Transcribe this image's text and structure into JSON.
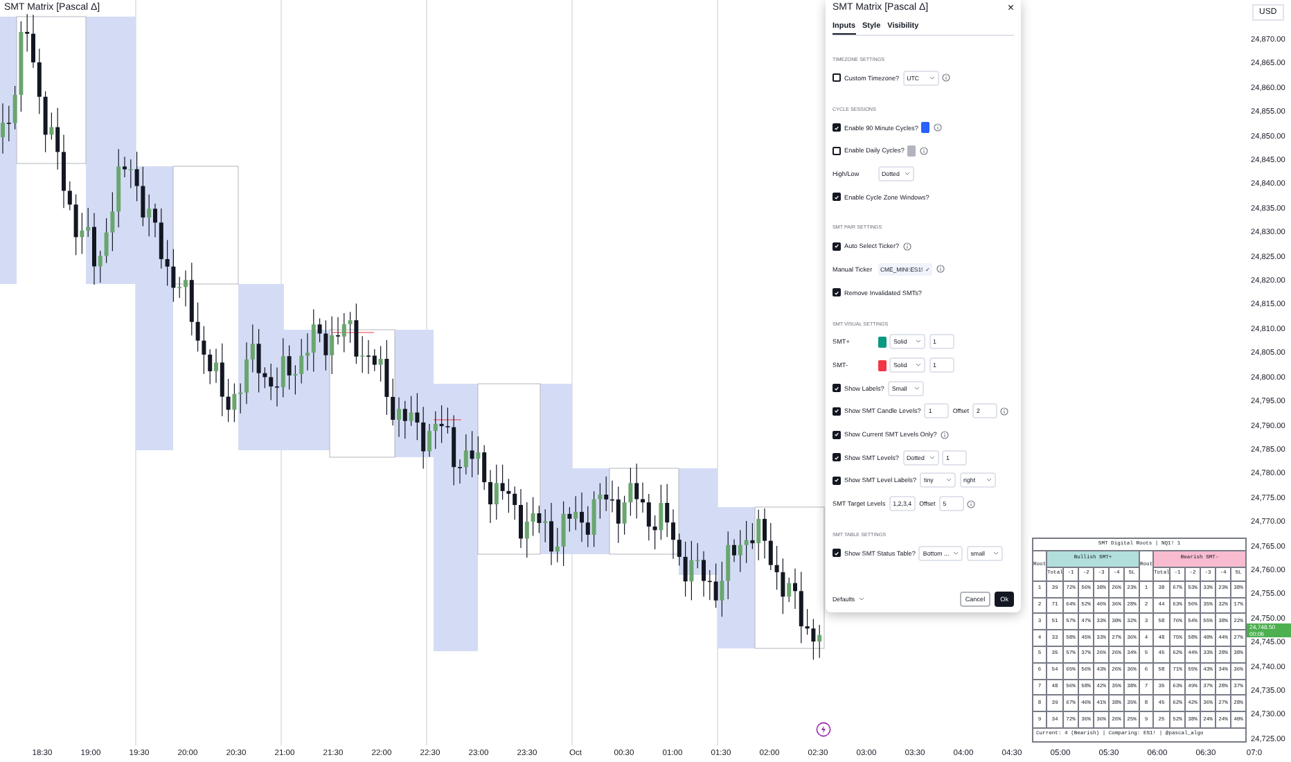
{
  "chart": {
    "legend": "SMT Matrix [Pascal Δ]"
  },
  "dialog": {
    "title": "SMT Matrix [Pascal Δ]",
    "close": "×",
    "tabs": [
      {
        "label": "Inputs",
        "selected": true
      },
      {
        "label": "Style",
        "selected": false
      },
      {
        "label": "Visibility",
        "selected": false
      }
    ],
    "rows": [
      {
        "kind": "section",
        "label": "TIMEZONE SETTINGS"
      },
      {
        "kind": "check",
        "label": "Custom Timezone?",
        "checked": false,
        "controls": [
          {
            "kind": "select",
            "value": "UTC"
          },
          {
            "kind": "info"
          }
        ]
      },
      {
        "kind": "section",
        "label": "CYCLE SESSIONS"
      },
      {
        "kind": "check",
        "label": "Enable 90 Minute Cycles?",
        "checked": true,
        "controls": [
          {
            "kind": "swatch",
            "color": "#2962ff"
          },
          {
            "kind": "info"
          }
        ]
      },
      {
        "kind": "check",
        "label": "Enable Daily Cycles?",
        "checked": false,
        "controls": [
          {
            "kind": "swatch",
            "color": "#b2b5be"
          },
          {
            "kind": "info"
          }
        ]
      },
      {
        "kind": "field",
        "label": "High/Low",
        "controls": [
          {
            "kind": "select",
            "value": "Dotted"
          }
        ]
      },
      {
        "kind": "check",
        "label": "Enable Cycle Zone Windows?",
        "checked": true,
        "controls": []
      },
      {
        "kind": "section",
        "label": "SMT PAIR SETTINGS"
      },
      {
        "kind": "check",
        "label": "Auto Select Ticker?",
        "checked": true,
        "controls": [
          {
            "kind": "info"
          }
        ]
      },
      {
        "kind": "field",
        "label": "Manual Ticker",
        "controls": [
          {
            "kind": "ticker",
            "value": "CME_MINI:ES1!",
            "mark": "✓"
          },
          {
            "kind": "info"
          }
        ]
      },
      {
        "kind": "check",
        "label": "Remove Invalidated SMTs?",
        "checked": true,
        "controls": []
      },
      {
        "kind": "section",
        "label": "SMT VISUAL SETTINGS"
      },
      {
        "kind": "field",
        "label": "SMT+",
        "controls": [
          {
            "kind": "swatch",
            "color": "#089981"
          },
          {
            "kind": "select",
            "value": "Solid"
          },
          {
            "kind": "input",
            "value": "1"
          }
        ]
      },
      {
        "kind": "field",
        "label": "SMT-",
        "controls": [
          {
            "kind": "swatch",
            "color": "#f23645"
          },
          {
            "kind": "select",
            "value": "Solid"
          },
          {
            "kind": "input",
            "value": "1"
          }
        ]
      },
      {
        "kind": "check",
        "label": "Show Labels?",
        "checked": true,
        "controls": [
          {
            "kind": "select",
            "value": "Small"
          }
        ]
      },
      {
        "kind": "check",
        "label": "Show SMT Candle Levels?",
        "checked": true,
        "controls": [
          {
            "kind": "input",
            "value": "1"
          },
          {
            "kind": "text",
            "value": "Offset"
          },
          {
            "kind": "input",
            "value": "2"
          },
          {
            "kind": "info"
          }
        ]
      },
      {
        "kind": "check",
        "label": "Show Current SMT Levels Only?",
        "checked": true,
        "controls": [
          {
            "kind": "info"
          }
        ]
      },
      {
        "kind": "check",
        "label": "Show SMT Levels?",
        "checked": true,
        "controls": [
          {
            "kind": "select",
            "value": "Dotted"
          },
          {
            "kind": "input",
            "value": "1"
          }
        ]
      },
      {
        "kind": "check",
        "label": "Show SMT Level Labels?",
        "checked": true,
        "controls": [
          {
            "kind": "select",
            "value": "tiny"
          },
          {
            "kind": "select",
            "value": "right"
          }
        ]
      },
      {
        "kind": "field",
        "label": "SMT Target Levels",
        "controls": [
          {
            "kind": "input",
            "value": "1,2,3,4"
          },
          {
            "kind": "text",
            "value": "Offset"
          },
          {
            "kind": "input",
            "value": "5"
          },
          {
            "kind": "info"
          }
        ]
      },
      {
        "kind": "section",
        "label": "SMT TABLE SETTINGS"
      },
      {
        "kind": "check",
        "label": "Show SMT Status Table?",
        "checked": true,
        "controls": [
          {
            "kind": "select",
            "value": "Bottom ..."
          },
          {
            "kind": "select",
            "value": "small"
          }
        ]
      }
    ],
    "footer": {
      "defaults": "Defaults",
      "cancel": "Cancel",
      "ok": "Ok"
    }
  },
  "table": {
    "title": "SMT Digital Roots | NQ1! 1",
    "bull_root": "Root",
    "bullish": "Bullish SMT+",
    "bear_root": "Root",
    "bearish": "Bearish SMT-",
    "bull_columns": [
      "Total",
      "-1",
      "-2",
      "-3",
      "-4",
      "SL"
    ],
    "bear_columns": [
      "Total",
      "-1",
      "-2",
      "-3",
      "-4",
      "SL"
    ],
    "rows": [
      {
        "bull": [
          "1",
          "39",
          "72%",
          "56%",
          "38%",
          "26%",
          "23%"
        ],
        "bear": [
          "1",
          "38",
          "67%",
          "53%",
          "33%",
          "23%",
          "38%"
        ]
      },
      {
        "bull": [
          "2",
          "71",
          "64%",
          "52%",
          "46%",
          "36%",
          "28%"
        ],
        "bear": [
          "2",
          "44",
          "63%",
          "56%",
          "35%",
          "32%",
          "17%"
        ]
      },
      {
        "bull": [
          "3",
          "51",
          "57%",
          "47%",
          "33%",
          "30%",
          "32%"
        ],
        "bear": [
          "3",
          "58",
          "76%",
          "54%",
          "55%",
          "38%",
          "22%"
        ]
      },
      {
        "bull": [
          "4",
          "33",
          "58%",
          "45%",
          "33%",
          "27%",
          "36%"
        ],
        "bear": [
          "4",
          "48",
          "75%",
          "58%",
          "40%",
          "44%",
          "27%"
        ]
      },
      {
        "bull": [
          "5",
          "35",
          "57%",
          "37%",
          "26%",
          "26%",
          "34%"
        ],
        "bear": [
          "5",
          "45",
          "62%",
          "44%",
          "33%",
          "28%",
          "38%"
        ]
      },
      {
        "bull": [
          "6",
          "54",
          "65%",
          "56%",
          "43%",
          "26%",
          "36%"
        ],
        "bear": [
          "6",
          "58",
          "71%",
          "55%",
          "43%",
          "34%",
          "36%"
        ]
      },
      {
        "bull": [
          "7",
          "48",
          "56%",
          "58%",
          "42%",
          "35%",
          "38%"
        ],
        "bear": [
          "7",
          "35",
          "63%",
          "49%",
          "37%",
          "28%",
          "37%"
        ]
      },
      {
        "bull": [
          "8",
          "39",
          "67%",
          "46%",
          "41%",
          "38%",
          "35%"
        ],
        "bear": [
          "8",
          "45",
          "62%",
          "42%",
          "36%",
          "27%",
          "28%"
        ]
      },
      {
        "bull": [
          "9",
          "34",
          "72%",
          "36%",
          "36%",
          "26%",
          "25%"
        ],
        "bear": [
          "9",
          "25",
          "52%",
          "38%",
          "24%",
          "24%",
          "40%"
        ]
      }
    ],
    "footer": "Current: 4 (Bearish) | Comparing: ES1! | @pascal_algo"
  },
  "price_axis": {
    "currency": "USD",
    "labels": [
      "24,870.00",
      "24,865.00",
      "24,860.00",
      "24,855.00",
      "24,850.00",
      "24,845.00",
      "24,840.00",
      "24,835.00",
      "24,830.00",
      "24,825.00",
      "24,820.00",
      "24,815.00",
      "24,810.00",
      "24,805.00",
      "24,800.00",
      "24,795.00",
      "24,790.00",
      "24,785.00",
      "24,780.00",
      "24,775.00",
      "24,770.00",
      "24,765.00",
      "24,760.00",
      "24,755.00",
      "24,750.00",
      "24,745.00",
      "24,740.00",
      "24,735.00",
      "24,730.00",
      "24,725.00"
    ],
    "current_price": "24,748.50",
    "countdown": "00:06"
  },
  "time_axis": {
    "labels": [
      "18:30",
      "19:00",
      "19:30",
      "20:00",
      "20:30",
      "21:00",
      "21:30",
      "22:00",
      "22:30",
      "23:00",
      "23:30",
      "Oct",
      "00:30",
      "01:00",
      "01:30",
      "02:00",
      "02:30",
      "03:00",
      "03:30",
      "04:00",
      "04:30",
      "05:00",
      "05:30",
      "06:00",
      "06:30",
      "07:0"
    ]
  }
}
